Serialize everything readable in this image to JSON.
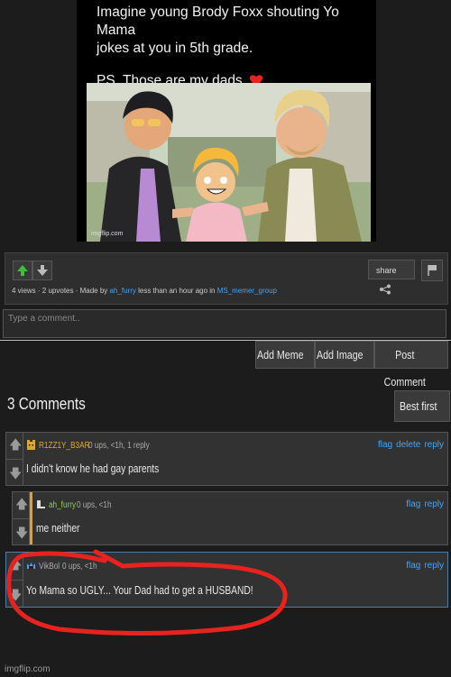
{
  "meme": {
    "tweet_line1": "Imagine young Brody Foxx shouting Yo Mama",
    "tweet_line2": "jokes at you in 5th grade.",
    "tweet_ps": "PS. Those are my dads",
    "heart_icon": "red-heart-icon",
    "watermark": "imgflip.com"
  },
  "stats": {
    "views": "4 views",
    "separator1": " · ",
    "upvotes": "2 upvotes",
    "made_by": " · Made by ",
    "author": "ah_furry",
    "time": " less than an hour ago in ",
    "group": "MS_memer_group",
    "share_label": "share"
  },
  "comment_input": {
    "placeholder": "Type a comment.."
  },
  "actions": {
    "add_meme": "Add Meme",
    "add_image": "Add Image",
    "post_comment": "Post Comment"
  },
  "comments_header": {
    "count_label": "3 Comments",
    "sort_label": "Best first ▾"
  },
  "comments": [
    {
      "user": "R1ZZ1Y_B3AR",
      "meta": "0 ups, <1h, 1 reply",
      "text": "I didn't know he had gay parents",
      "links": [
        "flag",
        "delete",
        "reply"
      ],
      "user_color": "#d9a832"
    },
    {
      "user": "ah_furry",
      "meta": "0 ups, <1h",
      "text": "me neither",
      "links": [
        "flag",
        "reply"
      ],
      "user_color": "#8ed14a"
    },
    {
      "user": "VikBol",
      "meta": "0 ups, <1h",
      "text": "Yo Mama so UGLY... Your Dad had to get a HUSBAND!",
      "links": [
        "flag",
        "reply"
      ],
      "user_color": "#aaaaaa"
    }
  ],
  "colors": {
    "link": "#3ea6ff",
    "accent_green": "#3fbf3f",
    "annotation_red": "#e8231f"
  },
  "footer": {
    "watermark": "imgflip.com"
  }
}
